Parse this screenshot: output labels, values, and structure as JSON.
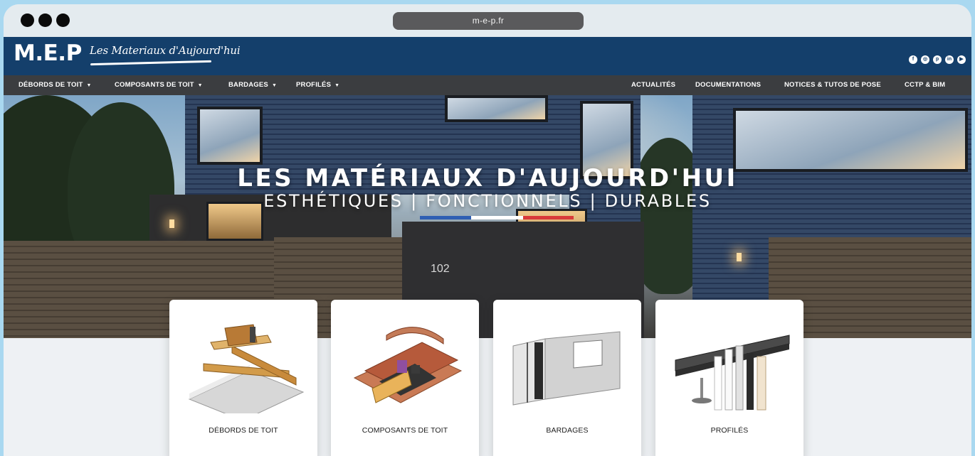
{
  "browser": {
    "url": "m-e-p.fr"
  },
  "header": {
    "logo": "M.E.P",
    "tagline": "Les Materiaux d'Aujourd'hui",
    "social_icons": [
      "facebook-icon",
      "instagram-icon",
      "pinterest-icon",
      "linkedin-icon",
      "youtube-icon"
    ]
  },
  "nav": {
    "left": [
      {
        "label": "DÉBORDS DE TOIT"
      },
      {
        "label": "COMPOSANTS DE TOIT"
      },
      {
        "label": "BARDAGES"
      },
      {
        "label": "PROFILÉS"
      }
    ],
    "right": [
      {
        "label": "ACTUALITÉS"
      },
      {
        "label": "DOCUMENTATIONS"
      },
      {
        "label": "NOTICES & TUTOS DE POSE"
      },
      {
        "label": "CCTP & BIM"
      }
    ]
  },
  "hero": {
    "title": "LES MATÉRIAUX D'AUJOURD'HUI",
    "subtitle": "ESTHÉTIQUES | FONCTIONNELS | DURABLES",
    "house_number": "102"
  },
  "cards": [
    {
      "label": "DÉBORDS DE TOIT"
    },
    {
      "label": "COMPOSANTS DE TOIT"
    },
    {
      "label": "BARDAGES"
    },
    {
      "label": "PROFILÉS"
    }
  ],
  "colors": {
    "header_bg": "#143f6b",
    "nav_bg": "#3b3d40",
    "flag_blue": "#2f5fb3",
    "flag_white": "#ffffff",
    "flag_red": "#d93a3a"
  }
}
